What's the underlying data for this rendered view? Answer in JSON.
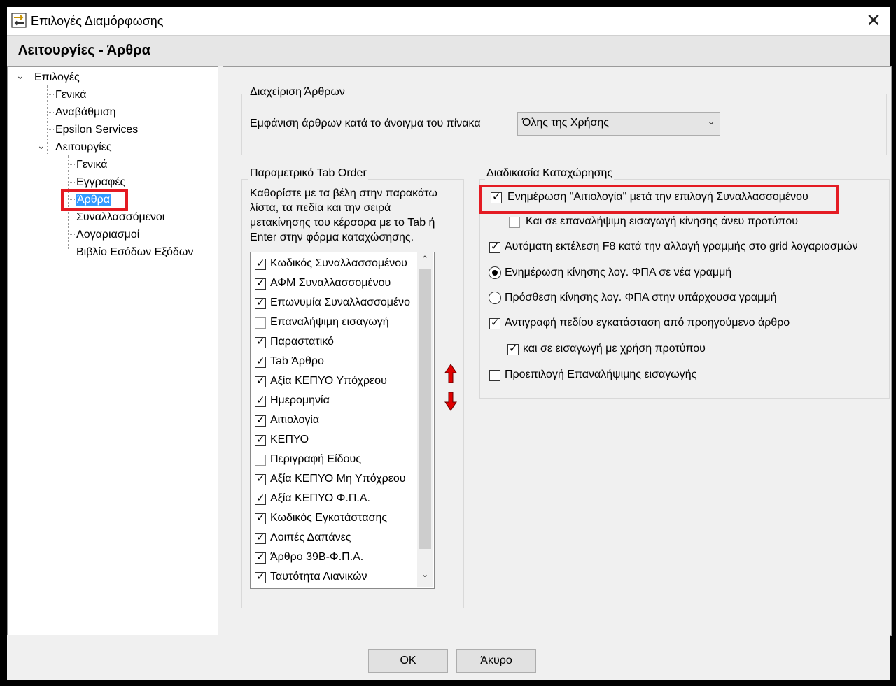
{
  "window": {
    "title": "Επιλογές Διαμόρφωσης",
    "close_glyph": "✕"
  },
  "header": {
    "title": "Λειτουργίες - Άρθρα"
  },
  "tree": {
    "root": "Επιλογές",
    "items_level1": [
      "Γενικά",
      "Αναβάθμιση",
      "Epsilon Services"
    ],
    "functions": "Λειτουργίες",
    "items_level2": [
      "Γενικά",
      "Εγγραφές",
      "Άρθρα",
      "Συναλλασσόμενοι",
      "Λογαριασμοί",
      "Βιβλίο Εσόδων Εξόδων"
    ]
  },
  "articles_group": {
    "title": "Διαχείριση Άρθρων",
    "display_label": "Εμφάνιση άρθρων κατά το άνοιγμα του πίνακα",
    "display_value": "Όλης της Χρήσης"
  },
  "tab_order_group": {
    "title": "Παραμετρικό Tab Order",
    "description": [
      "Καθορίστε με τα βέλη στην παρακάτω",
      "λίστα, τα πεδία και την σειρά",
      "μετακίνησης του κέρσορα με το Tab ή",
      "Enter στην φόρμα καταχώσησης."
    ],
    "items": [
      {
        "label": "Κωδικός Συναλλασσομένου",
        "checked": true
      },
      {
        "label": "ΑΦΜ Συναλλασσομένου",
        "checked": true
      },
      {
        "label": "Επωνυμία Συναλλασσομένο",
        "checked": true
      },
      {
        "label": "Επαναλήψιμη εισαγωγή",
        "checked": false
      },
      {
        "label": "Παραστατικό",
        "checked": true
      },
      {
        "label": "Tab Άρθρο",
        "checked": true
      },
      {
        "label": "Αξία ΚΕΠΥΟ Υπόχρεου",
        "checked": true
      },
      {
        "label": "Ημερομηνία",
        "checked": true
      },
      {
        "label": "Αιτιολογία",
        "checked": true
      },
      {
        "label": "ΚΕΠΥΟ",
        "checked": true
      },
      {
        "label": "Περιγραφή Είδους",
        "checked": false
      },
      {
        "label": "Αξία ΚΕΠΥΟ Μη Υπόχρεου",
        "checked": true
      },
      {
        "label": "Αξία ΚΕΠΥΟ Φ.Π.Α.",
        "checked": true
      },
      {
        "label": "Κωδικός Εγκατάστασης",
        "checked": true
      },
      {
        "label": "Λοιπές Δαπάνες",
        "checked": true
      },
      {
        "label": "Άρθρο 39Β-Φ.Π.Α.",
        "checked": true
      },
      {
        "label": "Ταυτότητα Λιανικών",
        "checked": true
      }
    ]
  },
  "entry_group": {
    "title": "Διαδικασία Καταχώρησης",
    "opt1": "Ενημέρωση \"Αιτιολογία\" μετά την επιλογή Συναλλασσομένου",
    "opt1a": "Και σε επαναλήψιμη εισαγωγή κίνησης άνευ προτύπου",
    "opt2": "Αυτόματη εκτέλεση F8 κατά την αλλαγή γραμμής στο grid λογαριασμών",
    "radio1": "Ενημέρωση κίνησης λογ. ΦΠΑ σε νέα γραμμή",
    "radio2": "Πρόσθεση κίνησης λογ. ΦΠΑ στην υπάρχουσα γραμμή",
    "opt3": "Αντιγραφή πεδίου εγκατάσταση από προηγούμενο άρθρο",
    "opt3a": "και σε εισαγωγή με χρήση προτύπου",
    "opt4": "Προεπιλογή Επαναλήψιμης εισαγωγής"
  },
  "checkmark_glyph": "✓",
  "combo_arrow_glyph": "⌄",
  "tree_arrow_glyph": "⌄",
  "scroll_up_glyph": "⌃",
  "scroll_down_glyph": "⌄",
  "buttons": {
    "ok": "OK",
    "cancel": "Άκυρο"
  },
  "colors": {
    "highlight_box": "#e41b23",
    "selection": "#3399ff",
    "move_arrows": "#e00000"
  }
}
